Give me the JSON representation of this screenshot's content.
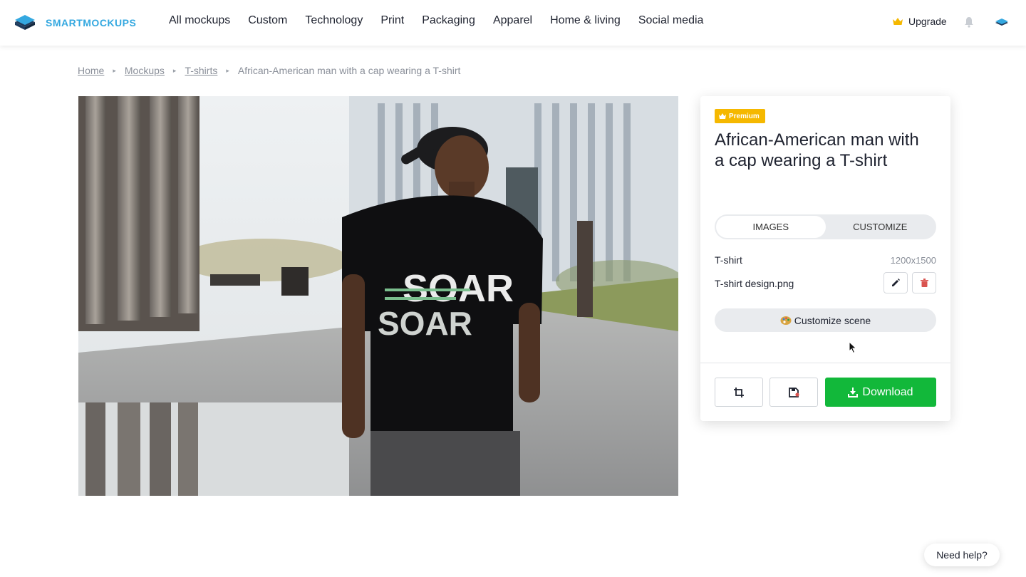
{
  "header": {
    "logo_text": "SMARTMOCKUPS",
    "nav": [
      "All mockups",
      "Custom",
      "Technology",
      "Print",
      "Packaging",
      "Apparel",
      "Home & living",
      "Social media"
    ],
    "upgrade_label": "Upgrade"
  },
  "breadcrumb": {
    "items": [
      "Home",
      "Mockups",
      "T-shirts"
    ],
    "current": "African-American man with a cap wearing a T-shirt"
  },
  "mockup": {
    "shirt_text": "SOAR"
  },
  "panel": {
    "badge": "Premium",
    "title": "African-American man with a cap wearing a T-shirt",
    "tabs": [
      "IMAGES",
      "CUSTOMIZE"
    ],
    "active_tab": "IMAGES",
    "item_label": "T-shirt",
    "item_size": "1200x1500",
    "design_file": "T-shirt design.png",
    "customize_scene_label": "Customize scene",
    "download_label": "Download"
  },
  "help": {
    "label": "Need help?"
  },
  "colors": {
    "brand": "#34a8e0",
    "premium": "#f5b800",
    "download": "#12b83a",
    "delete": "#d9534f"
  },
  "icons": [
    "logo-icon",
    "crown-icon",
    "bell-icon",
    "avatar-icon",
    "pencil-icon",
    "trash-icon",
    "palette-icon",
    "crop-icon",
    "save-icon",
    "download-icon",
    "cursor-icon"
  ]
}
